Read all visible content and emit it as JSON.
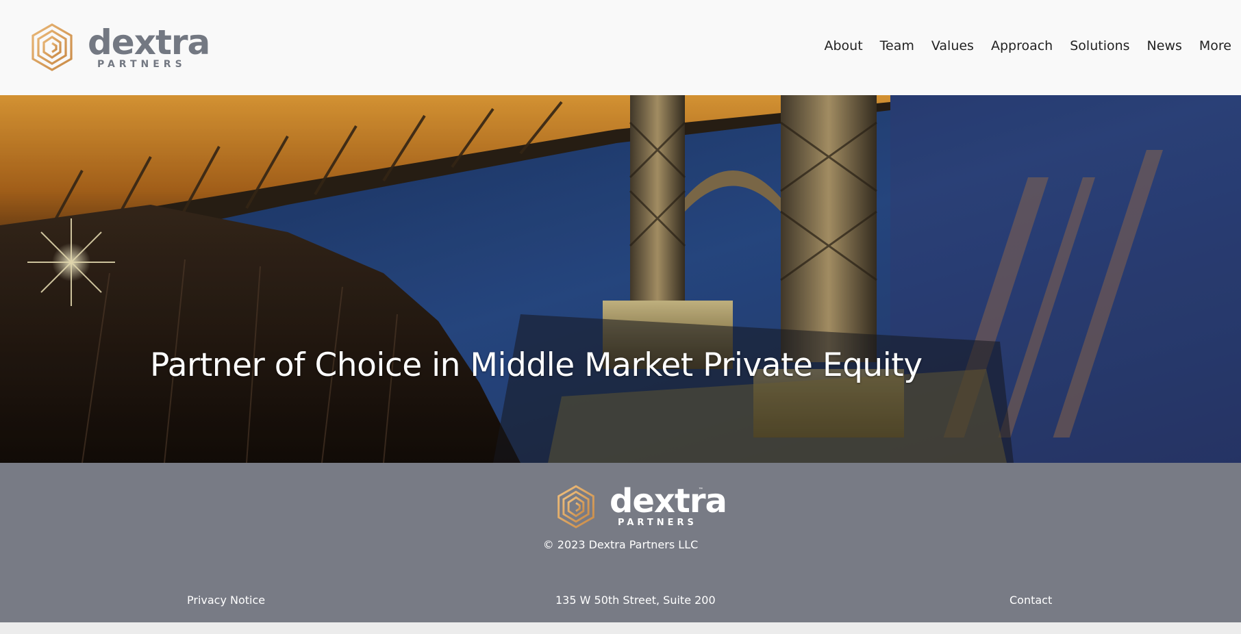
{
  "header": {
    "logo": {
      "wordmark": "dextra",
      "sub": "PARTNERS"
    },
    "nav": [
      "About",
      "Team",
      "Values",
      "Approach",
      "Solutions",
      "News",
      "More"
    ]
  },
  "hero": {
    "title": "Partner of Choice in Middle Market Private Equity"
  },
  "footer": {
    "logo": {
      "wordmark": "dextra",
      "sub": "PARTNERS",
      "tm": "™"
    },
    "copyright": "© 2023 Dextra Partners LLC",
    "links": {
      "privacy": "Privacy Notice",
      "address": "135 W 50th Street, Suite 200",
      "contact": "Contact"
    }
  },
  "colors": {
    "header_bg": "#f9f9f9",
    "footer_bg": "#787b85",
    "logo_gray": "#737882",
    "logo_gold": "#d9a366"
  }
}
